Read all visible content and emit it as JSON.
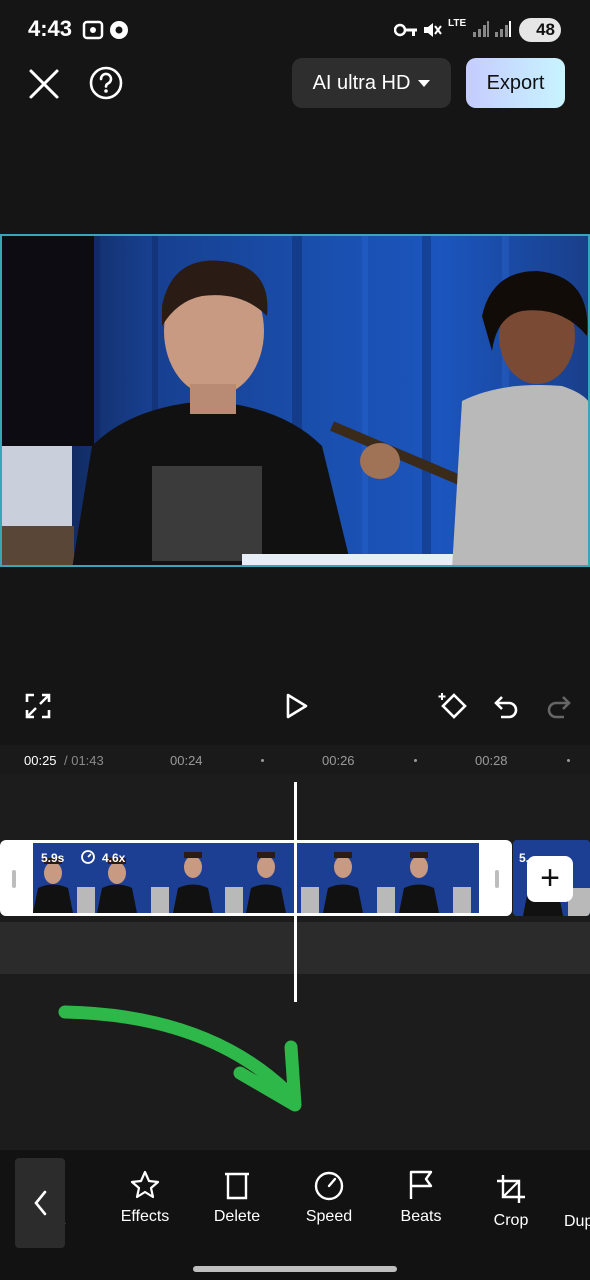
{
  "status_bar": {
    "time": "4:43",
    "network": "LTE",
    "battery": "48",
    "icons": [
      "screen-capture-icon",
      "soccer-ball-icon",
      "key-icon",
      "mute-icon",
      "signal-icon",
      "signal-icon",
      "battery-icon"
    ]
  },
  "top_bar": {
    "close_icon": "close-icon",
    "help_icon": "help-icon",
    "quality_label": "AI ultra HD",
    "export_label": "Export"
  },
  "controls": {
    "fullscreen_icon": "fullscreen-icon",
    "play_icon": "play-icon",
    "keyframe_icon": "keyframe-icon",
    "undo_icon": "undo-icon",
    "redo_icon": "redo-icon"
  },
  "timeline": {
    "current_time": "00:25",
    "total_time": "/ 01:43",
    "ticks": [
      "00:24",
      "00:26",
      "00:28"
    ],
    "clip": {
      "duration": "5.9s",
      "speed": "4.6x"
    },
    "next_clip_duration": "5.",
    "add_label": "+"
  },
  "toolbar": {
    "items": [
      {
        "label": "ons",
        "icon": "animations-icon"
      },
      {
        "label": "Effects",
        "icon": "effects-star-icon"
      },
      {
        "label": "Delete",
        "icon": "delete-icon"
      },
      {
        "label": "Speed",
        "icon": "speed-icon"
      },
      {
        "label": "Beats",
        "icon": "beats-flag-icon"
      },
      {
        "label": "Crop",
        "icon": "crop-icon"
      },
      {
        "label": "Dup",
        "icon": "duplicate-icon"
      }
    ]
  },
  "colors": {
    "accent_export": "#c5ccff",
    "preview_border": "#37a7b5",
    "arrow": "#2fb84a"
  }
}
